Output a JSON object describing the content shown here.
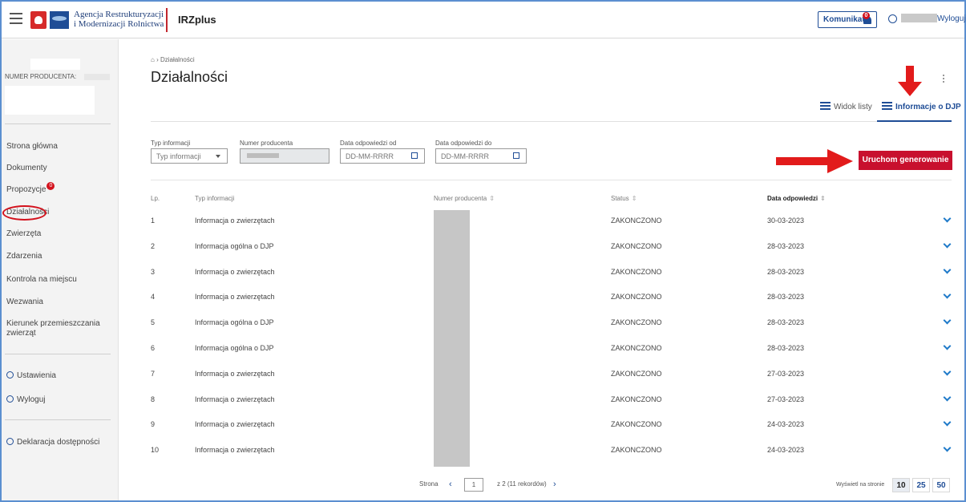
{
  "header": {
    "logo_line1": "Agencja Restrukturyzacji",
    "logo_line2": "i Modernizacji Rolnictwa",
    "app_name": "IRZplus",
    "komunikaty_label": "Komunikaty",
    "komunikaty_count": "0",
    "logout_label": "Wyloguj"
  },
  "sidebar": {
    "producer_label": "NUMER PRODUCENTA:",
    "items": [
      {
        "label": "Strona główna"
      },
      {
        "label": "Dokumenty"
      },
      {
        "label": "Propozycje",
        "badge": "0"
      },
      {
        "label": "Działalności"
      },
      {
        "label": "Zwierzęta"
      },
      {
        "label": "Zdarzenia"
      },
      {
        "label": "Kontrola na miejscu"
      },
      {
        "label": "Wezwania"
      },
      {
        "label": "Kierunek przemieszczania zwierząt"
      }
    ],
    "settings_label": "Ustawienia",
    "logout_label": "Wyloguj",
    "accessibility_label": "Deklaracja dostępności"
  },
  "main": {
    "breadcrumb": "Działalności",
    "title": "Działalności",
    "tabs": [
      {
        "label": "Widok listy"
      },
      {
        "label": "Informacje o DJP",
        "active": true
      }
    ],
    "filters": {
      "typ_label": "Typ informacji",
      "typ_placeholder": "Typ informacji",
      "numer_label": "Numer producenta",
      "od_label": "Data odpowiedzi od",
      "od_placeholder": "DD-MM-RRRR",
      "do_label": "Data odpowiedzi do",
      "do_placeholder": "DD-MM-RRRR"
    },
    "generate_button": "Uruchom generowanie DJP",
    "table": {
      "headers": [
        "Lp.",
        "Typ informacji",
        "Numer producenta",
        "Status",
        "Data odpowiedzi"
      ],
      "rows": [
        {
          "lp": "1",
          "typ": "Informacja o zwierzętach",
          "status": "ZAKONCZONO",
          "data": "30-03-2023"
        },
        {
          "lp": "2",
          "typ": "Informacja ogólna o DJP",
          "status": "ZAKONCZONO",
          "data": "28-03-2023"
        },
        {
          "lp": "3",
          "typ": "Informacja o zwierzętach",
          "status": "ZAKONCZONO",
          "data": "28-03-2023"
        },
        {
          "lp": "4",
          "typ": "Informacja o zwierzętach",
          "status": "ZAKONCZONO",
          "data": "28-03-2023"
        },
        {
          "lp": "5",
          "typ": "Informacja ogólna o DJP",
          "status": "ZAKONCZONO",
          "data": "28-03-2023"
        },
        {
          "lp": "6",
          "typ": "Informacja ogólna o DJP",
          "status": "ZAKONCZONO",
          "data": "28-03-2023"
        },
        {
          "lp": "7",
          "typ": "Informacja o zwierzętach",
          "status": "ZAKONCZONO",
          "data": "27-03-2023"
        },
        {
          "lp": "8",
          "typ": "Informacja o zwierzętach",
          "status": "ZAKONCZONO",
          "data": "27-03-2023"
        },
        {
          "lp": "9",
          "typ": "Informacja o zwierzętach",
          "status": "ZAKONCZONO",
          "data": "24-03-2023"
        },
        {
          "lp": "10",
          "typ": "Informacja o zwierzętach",
          "status": "ZAKONCZONO",
          "data": "24-03-2023"
        }
      ]
    },
    "pagination": {
      "strona_label": "Strona",
      "current_page": "1",
      "of_text": "z 2 (11 rekordów)",
      "per_page_label": "Wyświetl na stronie",
      "per_page_options": [
        "10",
        "25",
        "50"
      ]
    }
  },
  "colors": {
    "accent": "#1f4d96",
    "danger": "#c8102e",
    "frame": "#5b8fd0"
  }
}
